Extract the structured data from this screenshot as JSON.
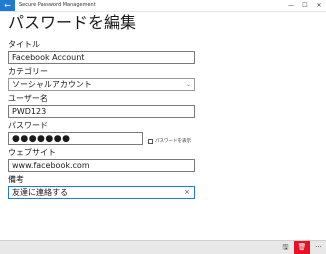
{
  "window": {
    "title": "Secure Password Management",
    "back_glyph": "←",
    "min_glyph": "—",
    "max_glyph": "☐",
    "close_glyph": "✕"
  },
  "page": {
    "title": "パスワードを編集"
  },
  "form": {
    "title_label": "タイトル",
    "title_value": "Facebook Account",
    "category_label": "カテゴリー",
    "category_value": "ソーシャルアカウント",
    "username_label": "ユーザー名",
    "username_value": "PWD123",
    "password_label": "パスワード",
    "password_value": "●●●●●●●",
    "show_password_label": "パスワードを表示",
    "website_label": "ウェブサイト",
    "website_value": "www.facebook.com",
    "note_label": "備考",
    "note_value": "友達に連絡する"
  },
  "bottombar": {
    "save_glyph": "🖫",
    "delete_glyph": "🗑",
    "more_glyph": "···"
  },
  "colors": {
    "accent": "#1f7ad1",
    "delete": "#e81123"
  },
  "icons": [
    "back-arrow-icon",
    "chevron-down-icon",
    "clear-x-icon",
    "save-icon",
    "trash-icon",
    "more-icon"
  ]
}
